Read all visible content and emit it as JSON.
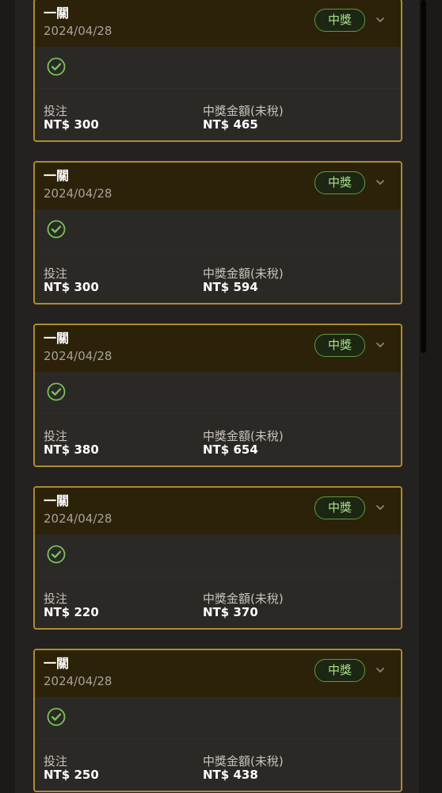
{
  "cards": [
    {
      "title": "一關",
      "date": "2024/04/28",
      "status": "中獎",
      "bet_label": "投注",
      "bet_value": "NT$ 300",
      "win_label": "中獎金額(未稅)",
      "win_value": "NT$ 465"
    },
    {
      "title": "一關",
      "date": "2024/04/28",
      "status": "中獎",
      "bet_label": "投注",
      "bet_value": "NT$ 300",
      "win_label": "中獎金額(未稅)",
      "win_value": "NT$ 594"
    },
    {
      "title": "一關",
      "date": "2024/04/28",
      "status": "中獎",
      "bet_label": "投注",
      "bet_value": "NT$ 380",
      "win_label": "中獎金額(未稅)",
      "win_value": "NT$ 654"
    },
    {
      "title": "一關",
      "date": "2024/04/28",
      "status": "中獎",
      "bet_label": "投注",
      "bet_value": "NT$ 220",
      "win_label": "中獎金額(未稅)",
      "win_value": "NT$ 370"
    },
    {
      "title": "一關",
      "date": "2024/04/28",
      "status": "中獎",
      "bet_label": "投注",
      "bet_value": "NT$ 250",
      "win_label": "中獎金額(未稅)",
      "win_value": "NT$ 438"
    }
  ],
  "icons": {
    "status_icon": "check-circle-icon",
    "expand_icon": "chevron-down-icon"
  },
  "colors": {
    "card_border": "#b08a2e",
    "badge_text": "#a8e089",
    "badge_border": "#5f9a45",
    "check": "#7bc15a"
  }
}
